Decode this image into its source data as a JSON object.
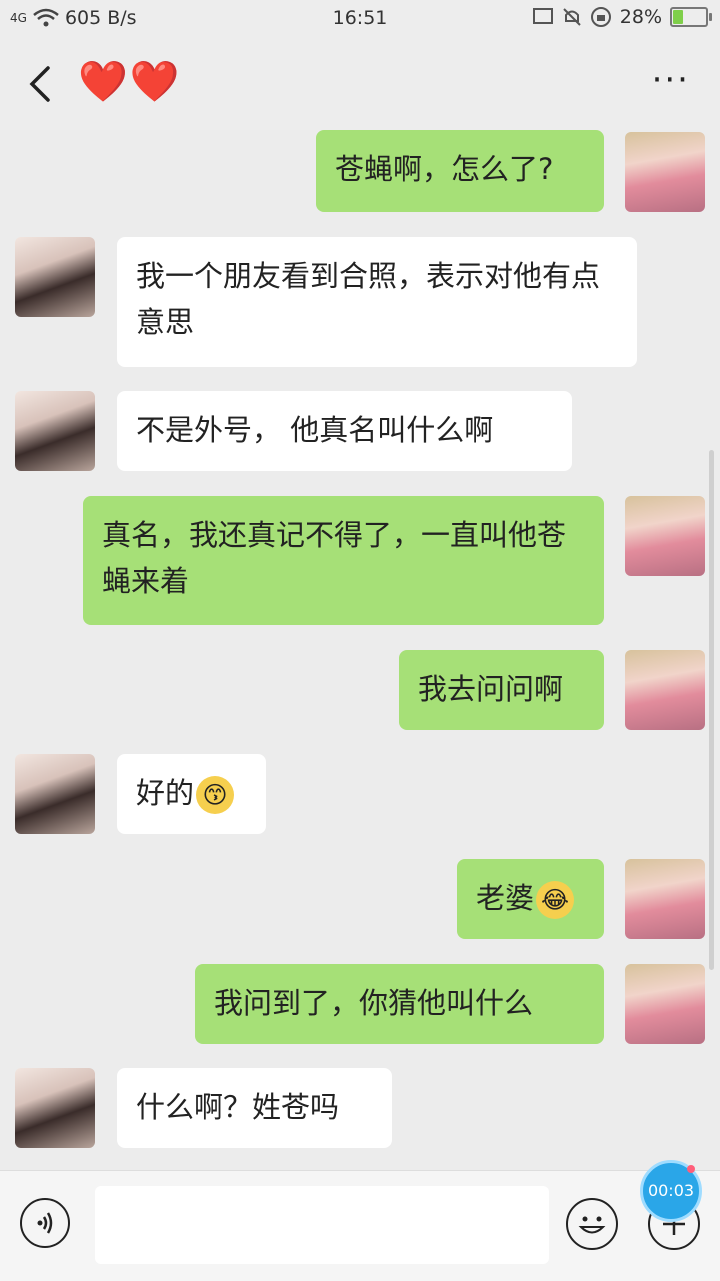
{
  "status": {
    "network": "4G",
    "speed": "605 B/s",
    "time": "16:51",
    "battery_percent": "28%",
    "battery_level": 0.28
  },
  "header": {
    "title": "❤️❤️",
    "more": "···"
  },
  "messages": [
    {
      "side": "out",
      "text": "苍蝇啊，怎么了?"
    },
    {
      "side": "in",
      "text": "我一个朋友看到合照，表示对他有点意思"
    },
    {
      "side": "in",
      "text": "不是外号， 他真名叫什么啊"
    },
    {
      "side": "out",
      "text": "真名，我还真记不得了，一直叫他苍蝇来着"
    },
    {
      "side": "out",
      "text": "我去问问啊"
    },
    {
      "side": "in",
      "text": "好的",
      "emoji": "😙"
    },
    {
      "side": "out",
      "text": "老婆",
      "emoji": "😂"
    },
    {
      "side": "out",
      "text": "我问到了，你猜他叫什么"
    },
    {
      "side": "in",
      "text": "什么啊？姓苍吗"
    }
  ],
  "input": {
    "value": "",
    "timer": "00:03"
  },
  "colors": {
    "outgoing_bubble": "#a6e077",
    "incoming_bubble": "#ffffff",
    "background": "#ececec"
  }
}
